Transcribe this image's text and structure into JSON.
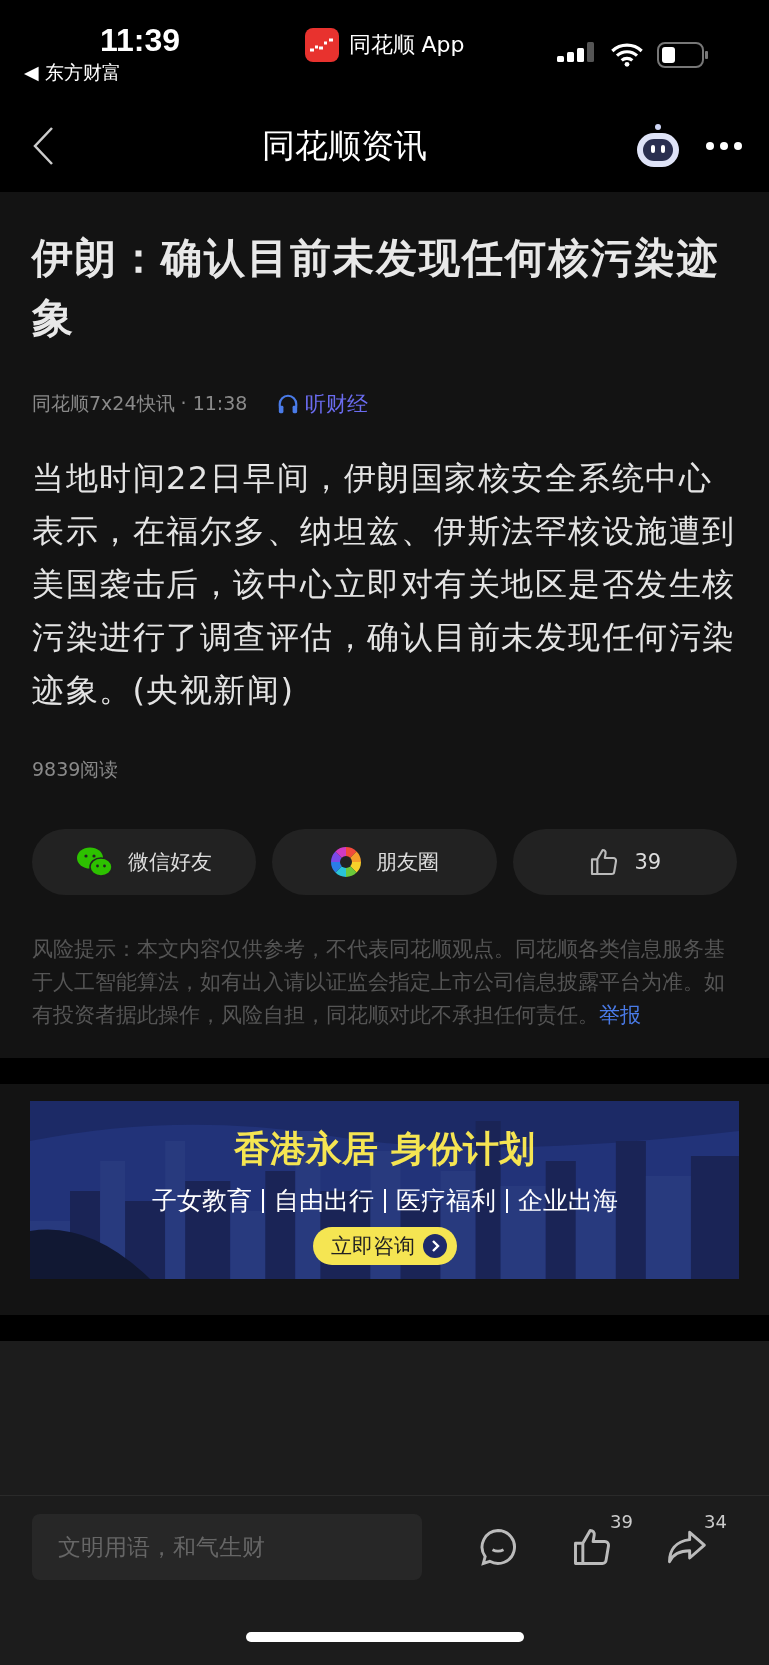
{
  "status_bar": {
    "time": "11:39",
    "back_app": "◀ 东方财富",
    "center_app": "同花顺 App"
  },
  "nav_bar": {
    "title": "同花顺资讯"
  },
  "article": {
    "title": "伊朗：确认目前未发现任何核污染迹象",
    "source": "同花顺7x24快讯 · 11:38",
    "listen": "听财经",
    "body": "当地时间22日早间，伊朗国家核安全系统中心表示，在福尔多、纳坦兹、伊斯法罕核设施遭到美国袭击后，该中心立即对有关地区是否发生核污染进行了调查评估，确认目前未发现任何污染迹象。(央视新闻)",
    "reads": "9839阅读"
  },
  "share_buttons": [
    {
      "kind": "wechat",
      "label": "微信好友"
    },
    {
      "kind": "moments",
      "label": "朋友圈"
    },
    {
      "kind": "like",
      "label": "39"
    }
  ],
  "disclaimer": {
    "text": "风险提示：本文内容仅供参考，不代表同花顺观点。同花顺各类信息服务基于人工智能算法，如有出入请以证监会指定上市公司信息披露平台为准。如有投资者据此操作，风险自担，同花顺对此不承担任何责任。",
    "report_link": "举报"
  },
  "ad_banner": {
    "headline": "香港永居 身份计划",
    "features": [
      "子女教育",
      "自由出行",
      "医疗福利",
      "企业出海"
    ],
    "cta": "立即咨询"
  },
  "bottom_bar": {
    "placeholder": "文明用语，和气生财",
    "actions": [
      {
        "kind": "comment"
      },
      {
        "kind": "like",
        "count": "39"
      },
      {
        "kind": "share",
        "count": "34"
      }
    ]
  }
}
